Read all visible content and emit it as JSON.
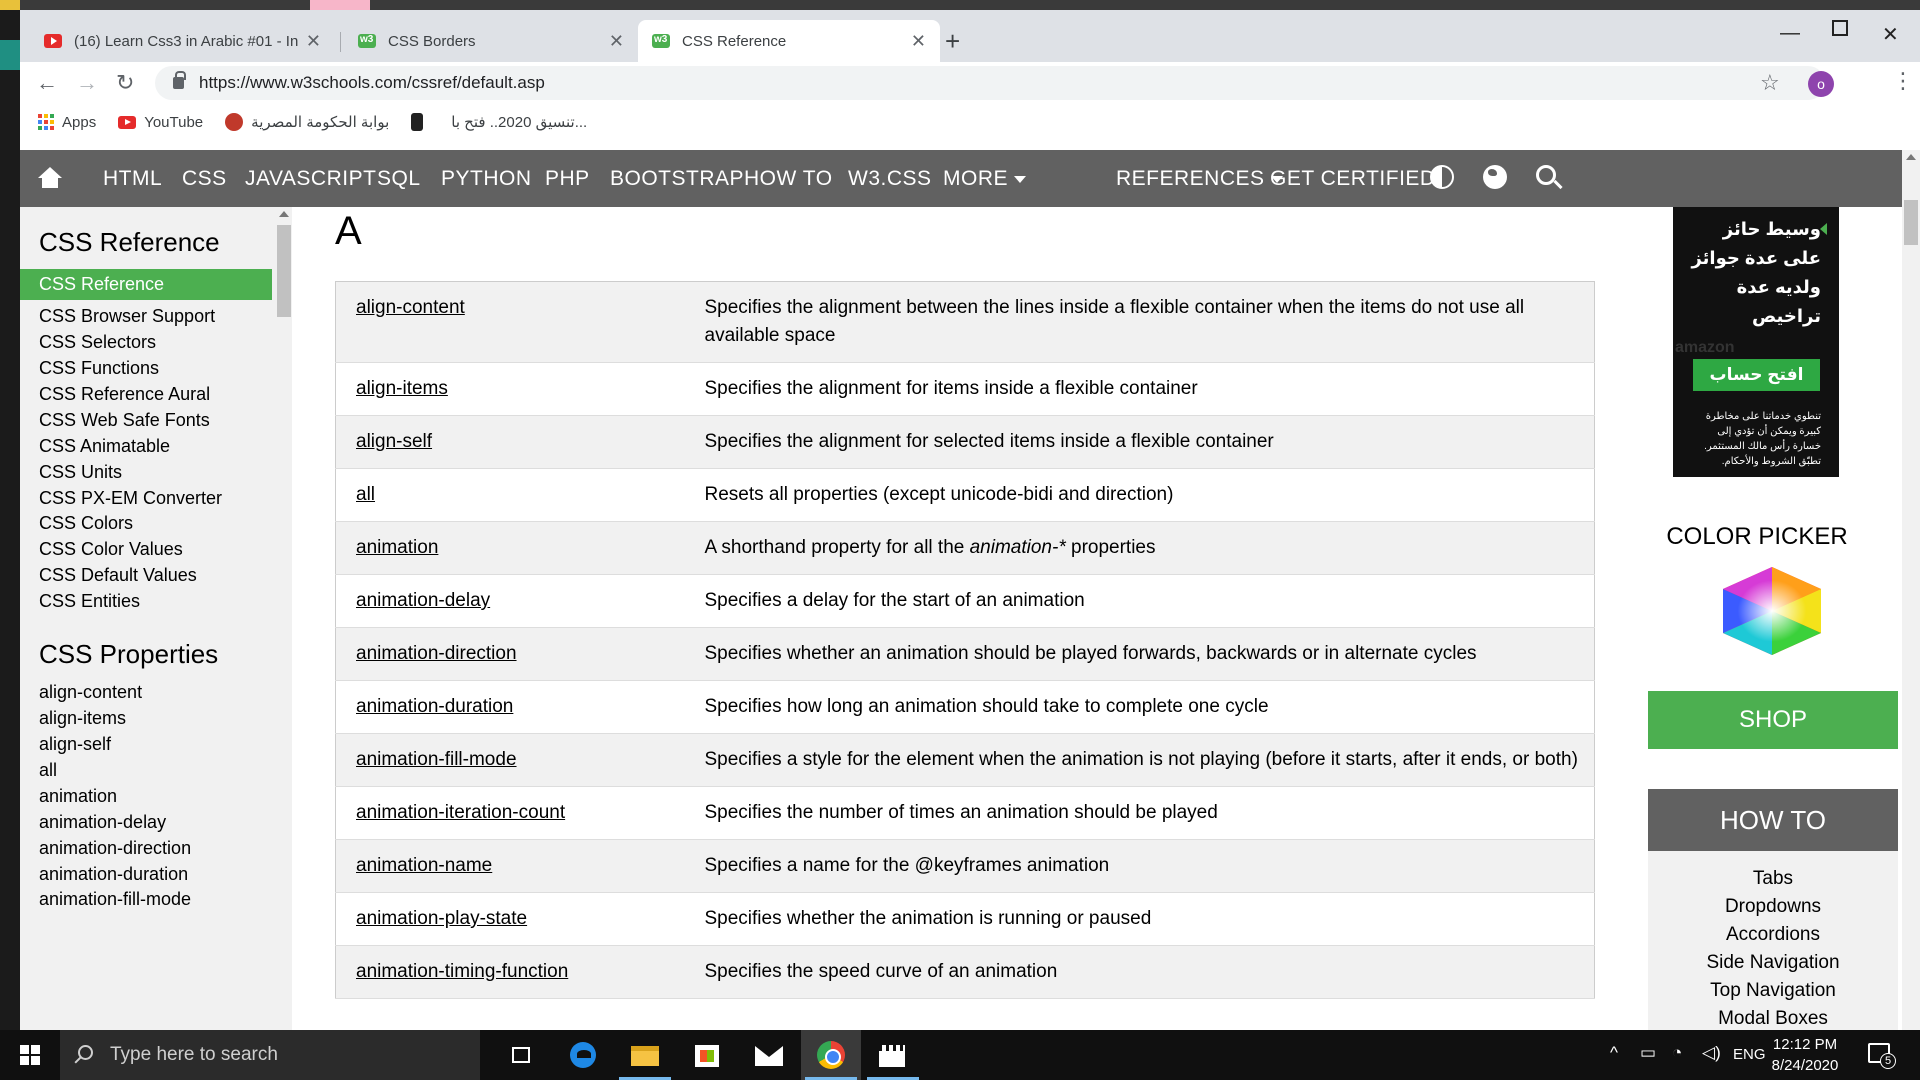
{
  "browser": {
    "tabs": [
      {
        "title": "(16) Learn Css3 in Arabic #01 - In",
        "favicon": "youtube-icon"
      },
      {
        "title": "CSS Borders",
        "favicon": "w3schools-icon"
      },
      {
        "title": "CSS Reference",
        "favicon": "w3schools-icon",
        "active": true
      }
    ],
    "url": "https://www.w3schools.com/cssref/default.asp",
    "profile_initial": "o",
    "bookmarks": [
      "Apps",
      "YouTube",
      "بوابة الحكومة المصرية",
      "تنسيق 2020.. فتح با..."
    ]
  },
  "topnav": {
    "links": [
      "HTML",
      "CSS",
      "JAVASCRIPT",
      "SQL",
      "PYTHON",
      "PHP",
      "BOOTSTRAP",
      "HOW TO",
      "W3.CSS"
    ],
    "more": "MORE",
    "references": "REFERENCES",
    "certified": "GET CERTIFIED!"
  },
  "sidebar": {
    "heading1": "CSS Reference",
    "reference_items": [
      "CSS Reference",
      "CSS Browser Support",
      "CSS Selectors",
      "CSS Functions",
      "CSS Reference Aural",
      "CSS Web Safe Fonts",
      "CSS Animatable",
      "CSS Units",
      "CSS PX-EM Converter",
      "CSS Colors",
      "CSS Color Values",
      "CSS Default Values",
      "CSS Entities"
    ],
    "heading2": "CSS Properties",
    "property_items": [
      "align-content",
      "align-items",
      "align-self",
      "all",
      "animation",
      "animation-delay",
      "animation-direction",
      "animation-duration",
      "animation-fill-mode"
    ]
  },
  "main": {
    "letter": "A",
    "properties": [
      {
        "name": "align-content",
        "desc": "Specifies the alignment between the lines inside a flexible container when the items do not use all available space"
      },
      {
        "name": "align-items",
        "desc": "Specifies the alignment for items inside a flexible container"
      },
      {
        "name": "align-self",
        "desc": "Specifies the alignment for selected items inside a flexible container"
      },
      {
        "name": "all",
        "desc": "Resets all properties (except unicode-bidi and direction)"
      },
      {
        "name": "animation",
        "desc_pre": "A shorthand property for all the ",
        "desc_em": "animation-*",
        "desc_post": " properties"
      },
      {
        "name": "animation-delay",
        "desc": "Specifies a delay for the start of an animation"
      },
      {
        "name": "animation-direction",
        "desc": "Specifies whether an animation should be played forwards, backwards or in alternate cycles"
      },
      {
        "name": "animation-duration",
        "desc": "Specifies how long an animation should take to complete one cycle"
      },
      {
        "name": "animation-fill-mode",
        "desc": "Specifies a style for the element when the animation is not playing (before it starts, after it ends, or both)"
      },
      {
        "name": "animation-iteration-count",
        "desc": "Specifies the number of times an animation should be played"
      },
      {
        "name": "animation-name",
        "desc": "Specifies a name for the @keyframes animation"
      },
      {
        "name": "animation-play-state",
        "desc": "Specifies whether the animation is running or paused"
      },
      {
        "name": "animation-timing-function",
        "desc": "Specifies the speed curve of an animation"
      }
    ]
  },
  "rightcol": {
    "ad": {
      "headline": "وسيط حائز على عدة جوائز ولديه عدة تراخيص",
      "watermark": "amazon",
      "button": "افتح حساب",
      "fineprint": "تنطوي خدماتنا على مخاطرة كبيرة ويمكن أن تؤدي إلى خسارة رأس مالك المستثمر. تطبّق الشروط والأحكام."
    },
    "color_picker": "COLOR PICKER",
    "shop": "SHOP",
    "howto_title": "HOW TO",
    "howto_links": [
      "Tabs",
      "Dropdowns",
      "Accordions",
      "Side Navigation",
      "Top Navigation",
      "Modal Boxes"
    ]
  },
  "taskbar": {
    "search_placeholder": "Type here to search",
    "language": "ENG",
    "time": "12:12 PM",
    "date": "8/24/2020",
    "notifications": "5"
  },
  "colors": {
    "w3_green": "#4caf50",
    "w3_nav": "#616161",
    "sidebar_bg": "#f1f1f1"
  }
}
